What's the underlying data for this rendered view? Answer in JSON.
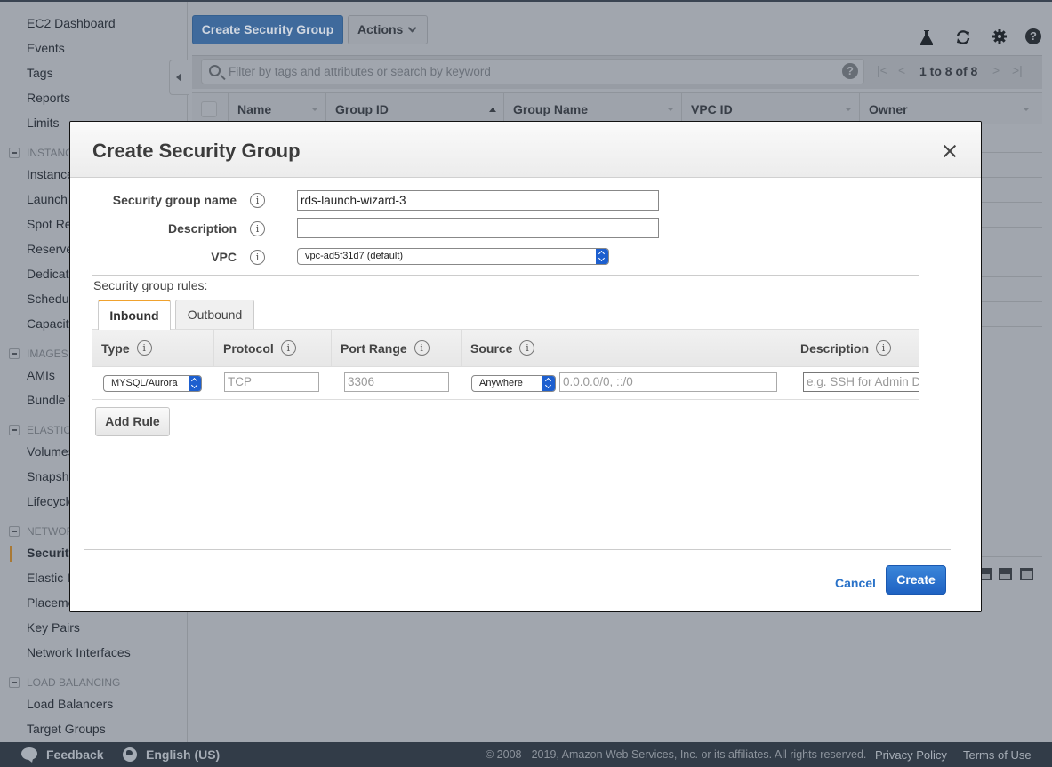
{
  "sidebar": {
    "items": [
      {
        "label": "EC2 Dashboard"
      },
      {
        "label": "Events"
      },
      {
        "label": "Tags"
      },
      {
        "label": "Reports"
      },
      {
        "label": "Limits"
      }
    ],
    "sections": [
      {
        "title": "INSTANCES",
        "items": [
          "Instances",
          "Launch Templates",
          "Spot Requests",
          "Reserved Instances",
          "Dedicated Hosts",
          "Scheduled Instances",
          "Capacity Reservations"
        ]
      },
      {
        "title": "IMAGES",
        "items": [
          "AMIs",
          "Bundle Tasks"
        ]
      },
      {
        "title": "ELASTIC BLOCK STORE",
        "items": [
          "Volumes",
          "Snapshots",
          "Lifecycle Manager"
        ]
      },
      {
        "title": "NETWORK & SECURITY",
        "items": [
          "Security Groups",
          "Elastic IPs",
          "Placement Groups",
          "Key Pairs",
          "Network Interfaces"
        ]
      },
      {
        "title": "LOAD BALANCING",
        "items": [
          "Load Balancers",
          "Target Groups"
        ]
      }
    ],
    "active_item": "Security Groups"
  },
  "toolbar": {
    "create_button": "Create Security Group",
    "actions_button": "Actions",
    "icons": [
      "flask-icon",
      "refresh-icon",
      "gear-icon",
      "help-icon"
    ]
  },
  "filter": {
    "placeholder": "Filter by tags and attributes or search by keyword",
    "pagination": "1 to 8 of 8"
  },
  "table": {
    "columns": [
      "Name",
      "Group ID",
      "Group Name",
      "VPC ID",
      "Owner"
    ],
    "sorted_column": "Group ID",
    "row_count": 8
  },
  "modal": {
    "title": "Create Security Group",
    "fields": {
      "name_label": "Security group name",
      "name_value": "rds-launch-wizard-3",
      "description_label": "Description",
      "description_value": "",
      "vpc_label": "VPC",
      "vpc_value": "vpc-ad5f31d7 (default)"
    },
    "rules_label": "Security group rules:",
    "tabs": [
      {
        "label": "Inbound",
        "active": true
      },
      {
        "label": "Outbound",
        "active": false
      }
    ],
    "rules_columns": [
      "Type",
      "Protocol",
      "Port Range",
      "Source",
      "Description"
    ],
    "rules": [
      {
        "type": "MYSQL/Aurora",
        "protocol": "TCP",
        "port_range": "3306",
        "source_type": "Anywhere",
        "source_value": "0.0.0.0/0, ::/0",
        "description_placeholder": "e.g. SSH for Admin Desktop"
      }
    ],
    "add_rule_button": "Add Rule",
    "cancel_button": "Cancel",
    "create_button": "Create",
    "info_glyph": "i"
  },
  "footer": {
    "feedback": "Feedback",
    "language": "English (US)",
    "copyright": "© 2008 - 2019, Amazon Web Services, Inc. or its affiliates. All rights reserved.",
    "privacy": "Privacy Policy",
    "terms": "Terms of Use"
  },
  "colors": {
    "primary_button": "#1f62c2",
    "link": "#2a72c8",
    "active_tab_accent": "#f0a22e",
    "select_arrow": "#1d5fcf",
    "footer_bg": "#323c48",
    "overlay_bg": "#a1a6ae"
  }
}
